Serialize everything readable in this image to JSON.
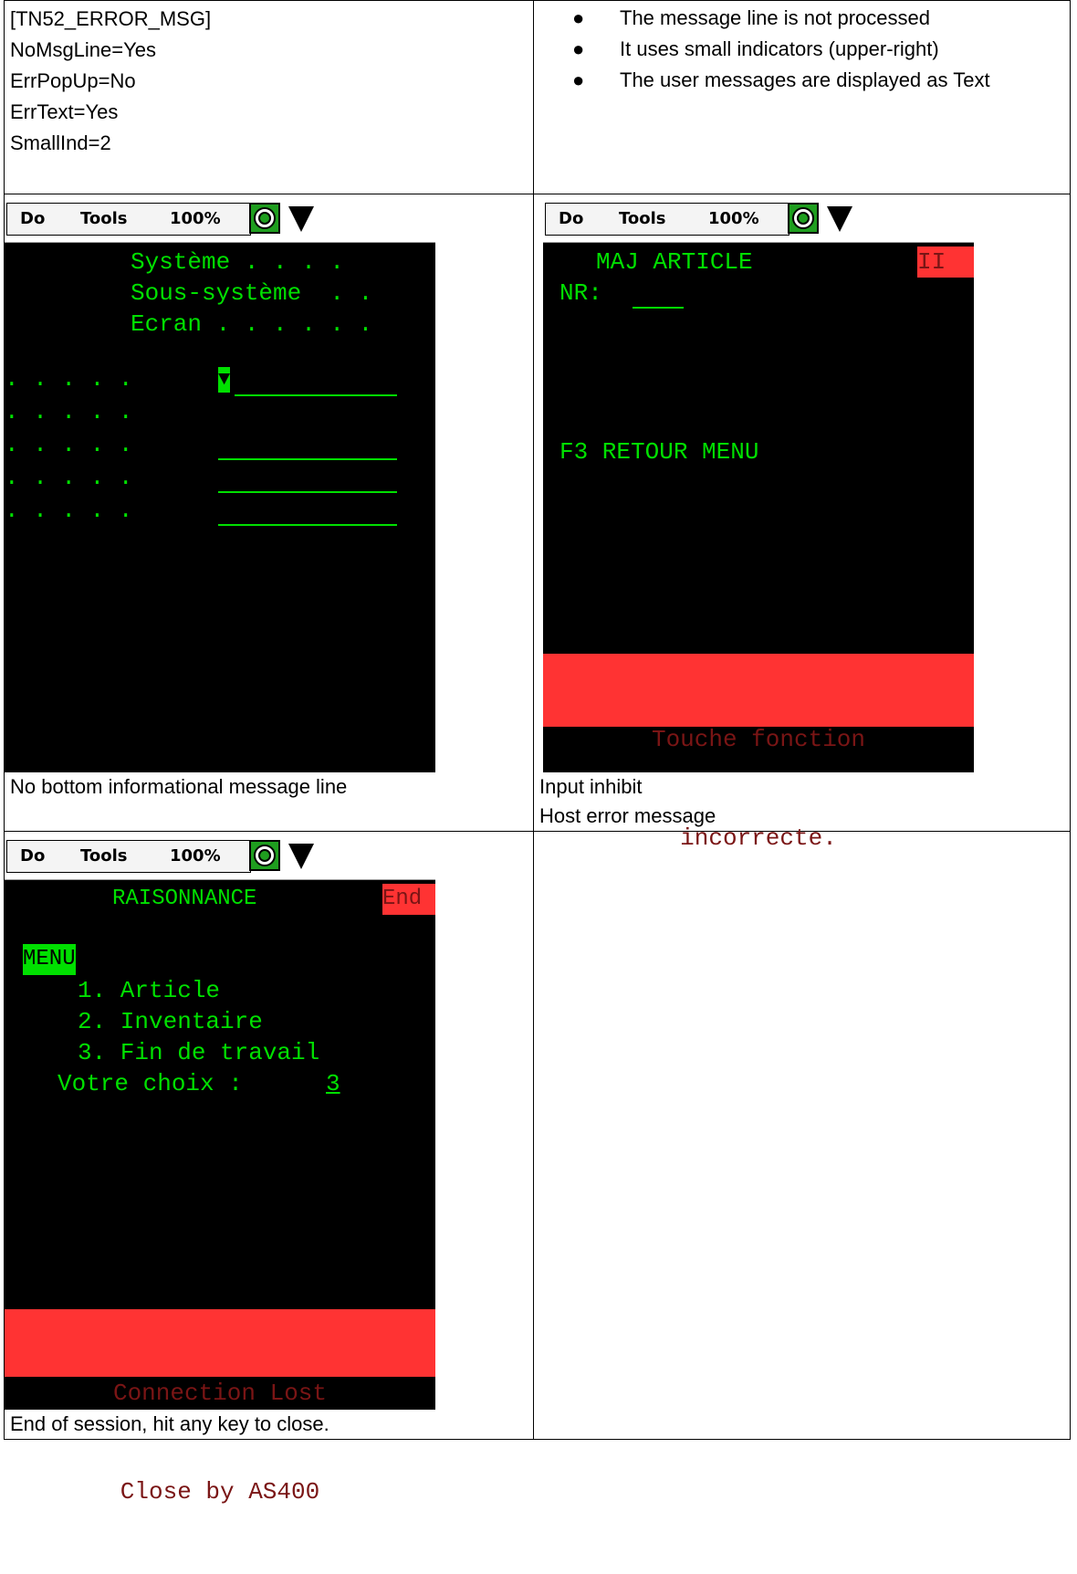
{
  "config": {
    "lines": [
      "[TN52_ERROR_MSG]",
      "NoMsgLine=Yes",
      "ErrPopUp=No",
      "ErrText=Yes",
      "SmallInd=2"
    ]
  },
  "notes": {
    "bullets": [
      "The message line is not processed",
      "It uses small indicators (upper-right)",
      "The user messages are displayed as Text"
    ]
  },
  "menubar": {
    "do_label": "Do",
    "tools_label": "Tools",
    "zoom_label": "100%",
    "icons": [
      "target-icon",
      "triangle-down-icon"
    ]
  },
  "screen1": {
    "lines": [
      "Système . . . .",
      "Sous-système  . .",
      "Ecran . . . . . ."
    ],
    "dots": [
      ". . . . .",
      ". . . . .",
      ". . . . .",
      ". . . . .",
      ". . . . ."
    ],
    "cursor": "▼",
    "caption": "No bottom informational message line"
  },
  "screen2": {
    "title": "MAJ ARTICLE",
    "indicator": "II",
    "nr_label": "NR: ",
    "nr_value": "___",
    "f3": "F3 RETOUR MENU",
    "error_line1": "Touche fonction",
    "error_line2": "incorrecte.",
    "caption1": "Input inhibit",
    "caption2": "Host error message"
  },
  "screen3": {
    "title": "RAISONNANCE",
    "indicator": "End",
    "menu_label": "MENU",
    "item1": "1. Article",
    "item2": "2. Inventaire",
    "item3": "3. Fin de travail",
    "prompt": "Votre choix :",
    "choice": "3",
    "error_line1": "Connection Lost",
    "error_line2": "Close by AS400",
    "caption": "End of session, hit any key to close."
  }
}
